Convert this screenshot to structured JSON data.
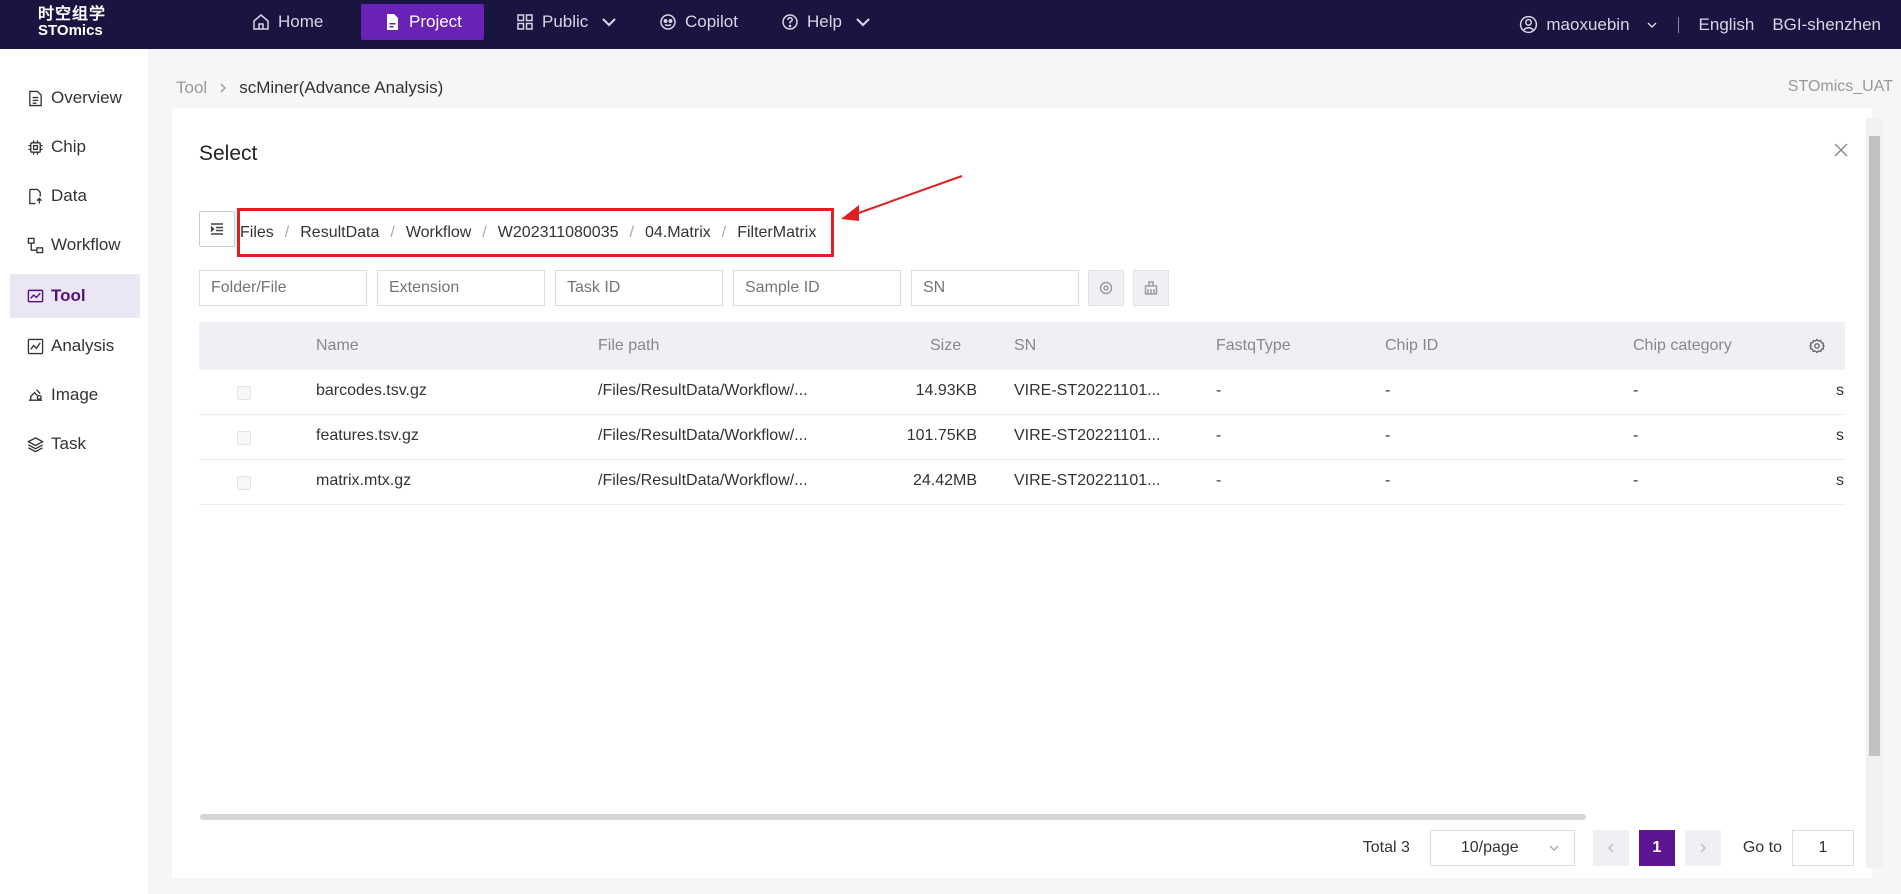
{
  "topbar": {
    "logo_cn": "时空组学",
    "logo_en": "STOmics",
    "nav": [
      {
        "label": "Home"
      },
      {
        "label": "Project"
      },
      {
        "label": "Public"
      },
      {
        "label": "Copilot"
      },
      {
        "label": "Help"
      }
    ],
    "user": "maoxuebin",
    "language": "English",
    "org": "BGI-shenzhen"
  },
  "sidebar": {
    "items": [
      {
        "label": "Overview",
        "icon": "document-icon"
      },
      {
        "label": "Chip",
        "icon": "chip-icon"
      },
      {
        "label": "Data",
        "icon": "data-icon"
      },
      {
        "label": "Workflow",
        "icon": "workflow-icon"
      },
      {
        "label": "Tool",
        "icon": "tool-icon"
      },
      {
        "label": "Analysis",
        "icon": "analysis-icon"
      },
      {
        "label": "Image",
        "icon": "image-icon"
      },
      {
        "label": "Task",
        "icon": "layers-icon"
      }
    ]
  },
  "page": {
    "breadcrumb_root": "Tool",
    "breadcrumb_current": "scMiner(Advance Analysis)",
    "env_tag": "STOmics_UAT"
  },
  "modal": {
    "title": "Select",
    "path": [
      "Files",
      "ResultData",
      "Workflow",
      "W202311080035",
      "04.Matrix",
      "FilterMatrix"
    ],
    "filters": {
      "folder_placeholder": "Folder/File",
      "extension_placeholder": "Extension",
      "taskid_placeholder": "Task ID",
      "sampleid_placeholder": "Sample ID",
      "sn_placeholder": "SN"
    },
    "columns": [
      "Name",
      "File path",
      "Size",
      "SN",
      "FastqType",
      "Chip ID",
      "Chip category"
    ],
    "rows": [
      {
        "name": "barcodes.tsv.gz",
        "path": "/Files/ResultData/Workflow/...",
        "size": "14.93KB",
        "sn": "VIRE-ST20221101...",
        "fastq": "-",
        "chip": "-",
        "category": "-",
        "extra": "s("
      },
      {
        "name": "features.tsv.gz",
        "path": "/Files/ResultData/Workflow/...",
        "size": "101.75KB",
        "sn": "VIRE-ST20221101...",
        "fastq": "-",
        "chip": "-",
        "category": "-",
        "extra": "s("
      },
      {
        "name": "matrix.mtx.gz",
        "path": "/Files/ResultData/Workflow/...",
        "size": "24.42MB",
        "sn": "VIRE-ST20221101...",
        "fastq": "-",
        "chip": "-",
        "category": "-",
        "extra": "s("
      }
    ],
    "pagination": {
      "total": "Total 3",
      "page_size": "10/page",
      "current": "1",
      "goto_label": "Go to",
      "goto_value": "1"
    }
  }
}
